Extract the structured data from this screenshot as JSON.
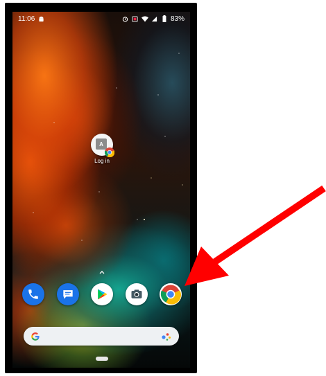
{
  "status_bar": {
    "time": "11:06",
    "battery": "83%",
    "icons": [
      "android-icon",
      "alarm-icon",
      "nfc-icon",
      "wifi-icon",
      "signal-icon",
      "battery-icon"
    ]
  },
  "home_screen": {
    "shortcut": {
      "label": "Log in",
      "initial": "A",
      "badge_icon": "chrome-icon"
    },
    "dock": [
      {
        "name": "Phone",
        "icon": "phone-icon",
        "color": "#1a73e8"
      },
      {
        "name": "Messages",
        "icon": "messages-icon",
        "color": "#1a73e8"
      },
      {
        "name": "Play Store",
        "icon": "play-store-icon",
        "color": "#ffffff"
      },
      {
        "name": "Camera",
        "icon": "camera-icon",
        "color": "#ffffff"
      },
      {
        "name": "Chrome",
        "icon": "chrome-icon",
        "color": "#ffffff"
      }
    ],
    "search": {
      "left_icon": "google-g-icon",
      "right_icon": "google-assistant-icon"
    }
  },
  "annotation": {
    "type": "arrow",
    "color": "#ff0000",
    "target": "Chrome"
  }
}
